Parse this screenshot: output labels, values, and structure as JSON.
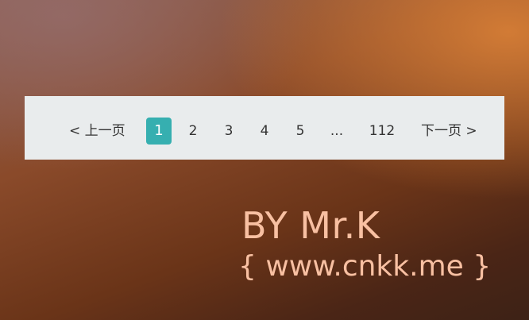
{
  "pagination": {
    "prev_label": "< 上一页",
    "pages": [
      "1",
      "2",
      "3",
      "4",
      "5"
    ],
    "current_page": "1",
    "ellipsis": "...",
    "last_page": "112",
    "next_label": "下一页 >"
  },
  "credit": {
    "byline": "BY Mr.K",
    "website": "{ www.cnkk.me }"
  },
  "colors": {
    "active_page_bg": "#36afb0",
    "bar_bg": "#e9eced",
    "credit_text": "#f8c0a2"
  }
}
